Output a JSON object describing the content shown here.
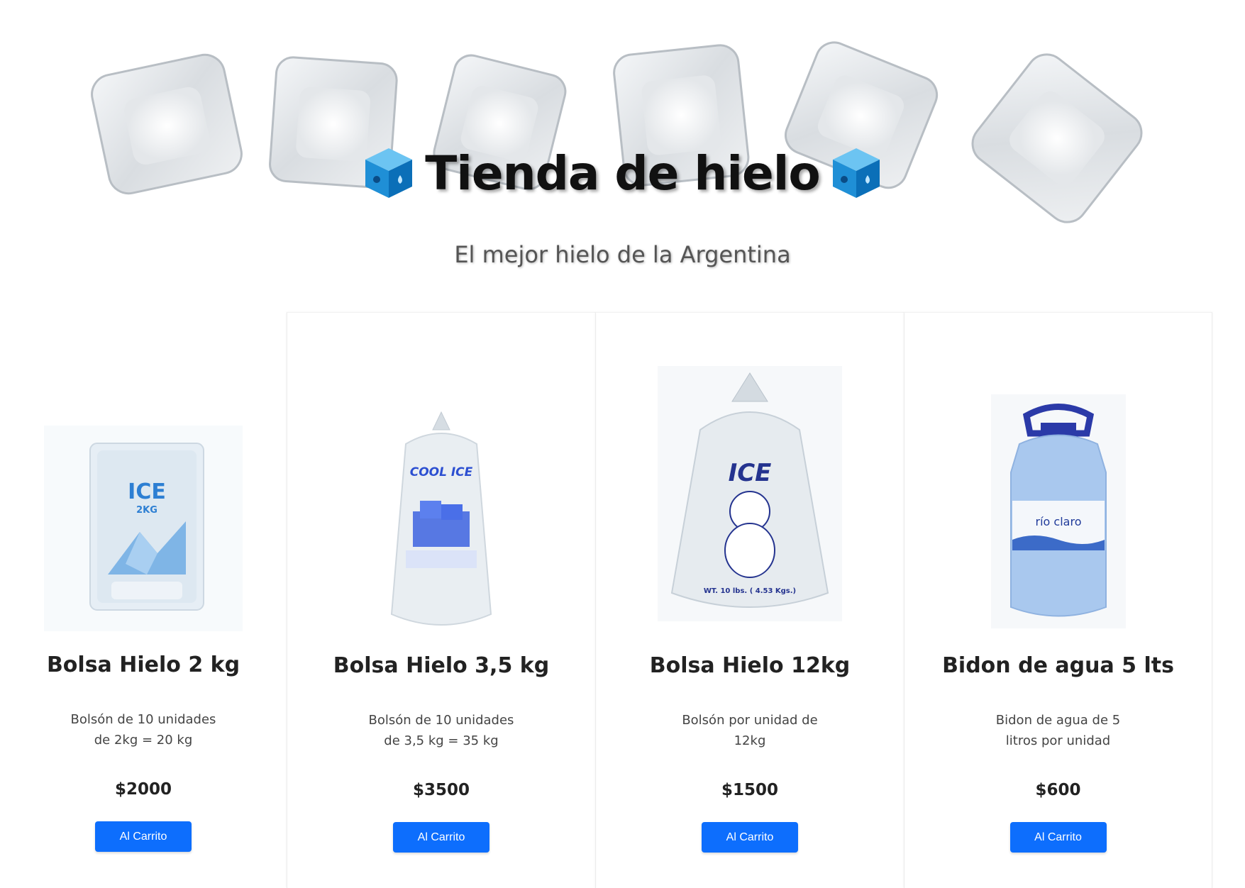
{
  "hero": {
    "title": "Tienda de hielo",
    "subtitle": "El mejor hielo de la Argentina",
    "title_icon": "ice-cube-emoji"
  },
  "colors": {
    "button": "#0d6efd",
    "title": "#111111",
    "subtitle": "#555555"
  },
  "products": [
    {
      "name": "Bolsa Hielo 2 kg",
      "description": "Bolsón de 10 unidades de 2kg = 20 kg",
      "price": "$2000",
      "button": "Al Carrito",
      "bag_brand": "ICE",
      "bag_weight": "2KG"
    },
    {
      "name": "Bolsa Hielo 3,5 kg",
      "description": "Bolsón de 10 unidades de 3,5 kg = 35 kg",
      "price": "$3500",
      "button": "Al Carrito",
      "bag_brand": "COOL ICE"
    },
    {
      "name": "Bolsa Hielo 12kg",
      "description": "Bolsón por unidad de 12kg",
      "price": "$1500",
      "button": "Al Carrito",
      "bag_brand": "ICE",
      "bag_weight": "WT. 10 lbs. ( 4.53 Kgs.)"
    },
    {
      "name": "Bidon de agua 5 lts",
      "description": "Bidon de agua de 5 litros por unidad",
      "price": "$600",
      "button": "Al Carrito",
      "bag_brand": "río claro"
    }
  ]
}
